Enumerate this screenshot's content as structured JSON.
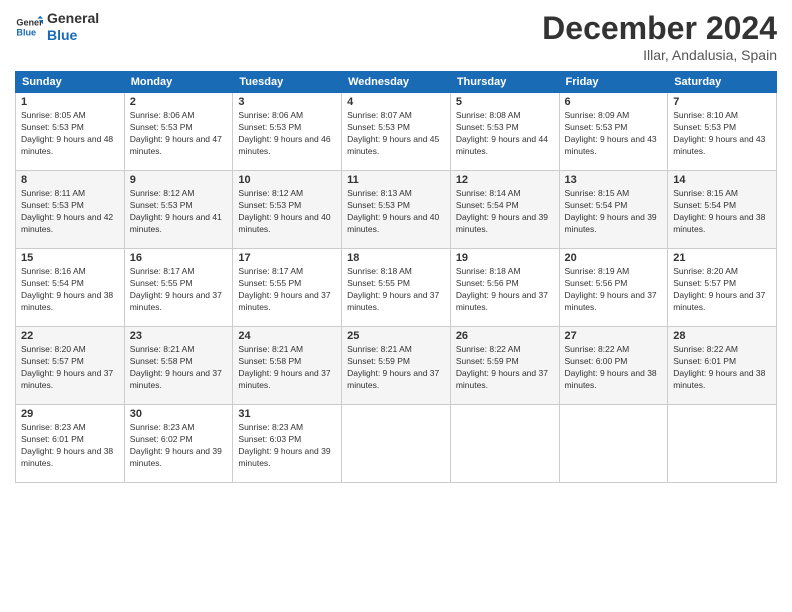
{
  "logo": {
    "line1": "General",
    "line2": "Blue"
  },
  "title": "December 2024",
  "location": "Illar, Andalusia, Spain",
  "weekdays": [
    "Sunday",
    "Monday",
    "Tuesday",
    "Wednesday",
    "Thursday",
    "Friday",
    "Saturday"
  ],
  "weeks": [
    [
      {
        "day": "1",
        "sunrise": "8:05 AM",
        "sunset": "5:53 PM",
        "daylight": "9 hours and 48 minutes."
      },
      {
        "day": "2",
        "sunrise": "8:06 AM",
        "sunset": "5:53 PM",
        "daylight": "9 hours and 47 minutes."
      },
      {
        "day": "3",
        "sunrise": "8:06 AM",
        "sunset": "5:53 PM",
        "daylight": "9 hours and 46 minutes."
      },
      {
        "day": "4",
        "sunrise": "8:07 AM",
        "sunset": "5:53 PM",
        "daylight": "9 hours and 45 minutes."
      },
      {
        "day": "5",
        "sunrise": "8:08 AM",
        "sunset": "5:53 PM",
        "daylight": "9 hours and 44 minutes."
      },
      {
        "day": "6",
        "sunrise": "8:09 AM",
        "sunset": "5:53 PM",
        "daylight": "9 hours and 43 minutes."
      },
      {
        "day": "7",
        "sunrise": "8:10 AM",
        "sunset": "5:53 PM",
        "daylight": "9 hours and 43 minutes."
      }
    ],
    [
      {
        "day": "8",
        "sunrise": "8:11 AM",
        "sunset": "5:53 PM",
        "daylight": "9 hours and 42 minutes."
      },
      {
        "day": "9",
        "sunrise": "8:12 AM",
        "sunset": "5:53 PM",
        "daylight": "9 hours and 41 minutes."
      },
      {
        "day": "10",
        "sunrise": "8:12 AM",
        "sunset": "5:53 PM",
        "daylight": "9 hours and 40 minutes."
      },
      {
        "day": "11",
        "sunrise": "8:13 AM",
        "sunset": "5:53 PM",
        "daylight": "9 hours and 40 minutes."
      },
      {
        "day": "12",
        "sunrise": "8:14 AM",
        "sunset": "5:54 PM",
        "daylight": "9 hours and 39 minutes."
      },
      {
        "day": "13",
        "sunrise": "8:15 AM",
        "sunset": "5:54 PM",
        "daylight": "9 hours and 39 minutes."
      },
      {
        "day": "14",
        "sunrise": "8:15 AM",
        "sunset": "5:54 PM",
        "daylight": "9 hours and 38 minutes."
      }
    ],
    [
      {
        "day": "15",
        "sunrise": "8:16 AM",
        "sunset": "5:54 PM",
        "daylight": "9 hours and 38 minutes."
      },
      {
        "day": "16",
        "sunrise": "8:17 AM",
        "sunset": "5:55 PM",
        "daylight": "9 hours and 37 minutes."
      },
      {
        "day": "17",
        "sunrise": "8:17 AM",
        "sunset": "5:55 PM",
        "daylight": "9 hours and 37 minutes."
      },
      {
        "day": "18",
        "sunrise": "8:18 AM",
        "sunset": "5:55 PM",
        "daylight": "9 hours and 37 minutes."
      },
      {
        "day": "19",
        "sunrise": "8:18 AM",
        "sunset": "5:56 PM",
        "daylight": "9 hours and 37 minutes."
      },
      {
        "day": "20",
        "sunrise": "8:19 AM",
        "sunset": "5:56 PM",
        "daylight": "9 hours and 37 minutes."
      },
      {
        "day": "21",
        "sunrise": "8:20 AM",
        "sunset": "5:57 PM",
        "daylight": "9 hours and 37 minutes."
      }
    ],
    [
      {
        "day": "22",
        "sunrise": "8:20 AM",
        "sunset": "5:57 PM",
        "daylight": "9 hours and 37 minutes."
      },
      {
        "day": "23",
        "sunrise": "8:21 AM",
        "sunset": "5:58 PM",
        "daylight": "9 hours and 37 minutes."
      },
      {
        "day": "24",
        "sunrise": "8:21 AM",
        "sunset": "5:58 PM",
        "daylight": "9 hours and 37 minutes."
      },
      {
        "day": "25",
        "sunrise": "8:21 AM",
        "sunset": "5:59 PM",
        "daylight": "9 hours and 37 minutes."
      },
      {
        "day": "26",
        "sunrise": "8:22 AM",
        "sunset": "5:59 PM",
        "daylight": "9 hours and 37 minutes."
      },
      {
        "day": "27",
        "sunrise": "8:22 AM",
        "sunset": "6:00 PM",
        "daylight": "9 hours and 38 minutes."
      },
      {
        "day": "28",
        "sunrise": "8:22 AM",
        "sunset": "6:01 PM",
        "daylight": "9 hours and 38 minutes."
      }
    ],
    [
      {
        "day": "29",
        "sunrise": "8:23 AM",
        "sunset": "6:01 PM",
        "daylight": "9 hours and 38 minutes."
      },
      {
        "day": "30",
        "sunrise": "8:23 AM",
        "sunset": "6:02 PM",
        "daylight": "9 hours and 39 minutes."
      },
      {
        "day": "31",
        "sunrise": "8:23 AM",
        "sunset": "6:03 PM",
        "daylight": "9 hours and 39 minutes."
      },
      null,
      null,
      null,
      null
    ]
  ]
}
